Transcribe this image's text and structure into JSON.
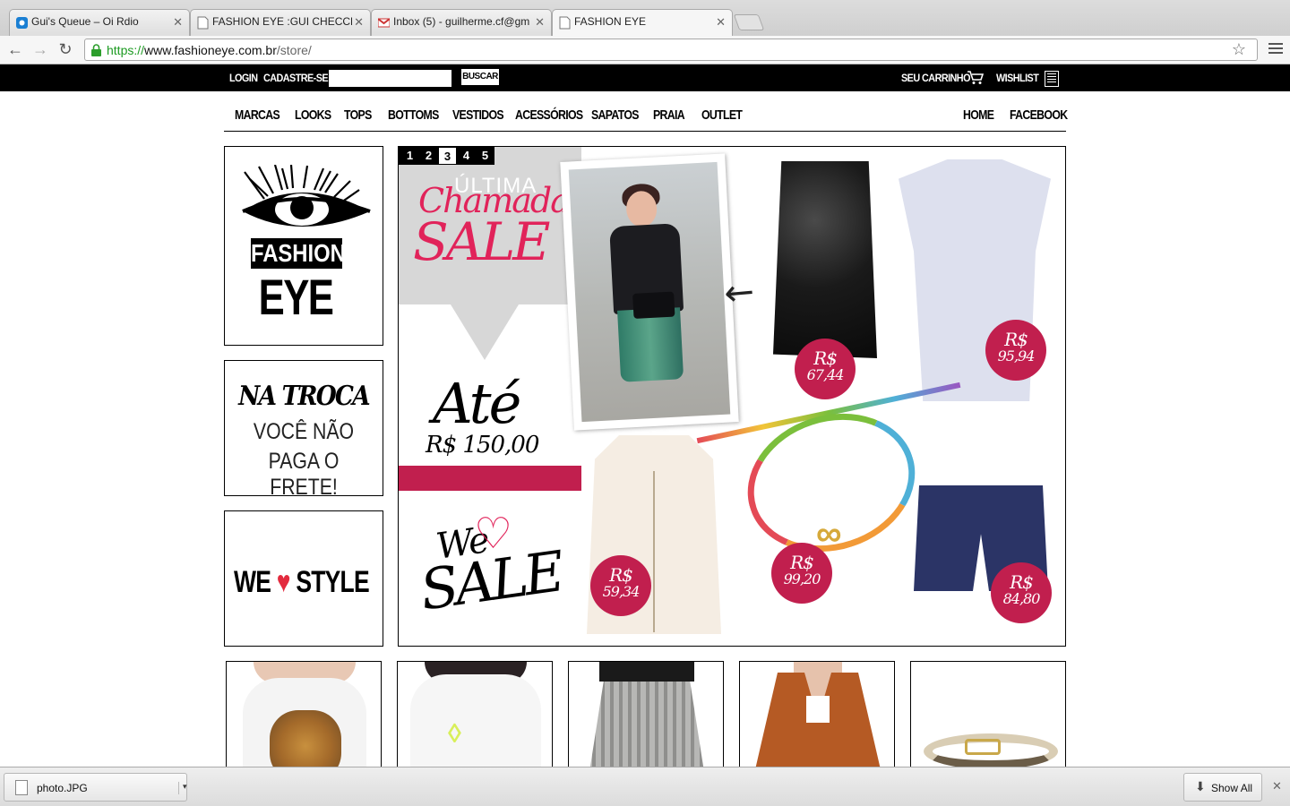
{
  "browser": {
    "tabs": [
      {
        "label": "Gui's Queue – Oi Rdio",
        "icon": "rdio-icon"
      },
      {
        "label": "FASHION EYE :GUI CHECCHIA",
        "icon": "page-icon"
      },
      {
        "label": "Inbox (5) - guilherme.cf@gm",
        "icon": "gmail-icon"
      },
      {
        "label": "FASHION EYE",
        "icon": "page-icon"
      }
    ],
    "url_scheme": "https://",
    "url_domain": "www.fashioneye.com.br",
    "url_path": "/store/"
  },
  "topbar": {
    "login": "LOGIN",
    "signup": "CADASTRE-SE",
    "search_value": "",
    "search_button": "BUSCAR",
    "cart": "SEU CARRINHO",
    "wishlist": "WISHLIST"
  },
  "nav": {
    "left": [
      "MARCAS",
      "LOOKS",
      "TOPS",
      "BOTTOMS",
      "VESTIDOS",
      "ACESSÓRIOS",
      "SAPATOS",
      "PRAIA",
      "OUTLET"
    ],
    "right": [
      "HOME",
      "FACEBOOK"
    ]
  },
  "logo": {
    "word1": "FASHION",
    "word2": "EYE"
  },
  "promo_troca": {
    "line1": "NA TROCA",
    "line2": "VOCÊ NÃO",
    "line3": "PAGA O FRETE!"
  },
  "promo_style": {
    "before": "WE",
    "heart": "♥",
    "after": "STYLE"
  },
  "banner": {
    "pages": [
      "1",
      "2",
      "3",
      "4",
      "5"
    ],
    "active_page": "3",
    "ultima": "ÚLTIMA",
    "chamada": "Chamada",
    "sale": "SALE",
    "ate": "Até",
    "ate_price": "R$ 150,00",
    "we": "We",
    "heart": "♡",
    "we_sale": "SALE",
    "prices": [
      {
        "currency": "R$",
        "value": "67,44"
      },
      {
        "currency": "R$",
        "value": "95,94"
      },
      {
        "currency": "R$",
        "value": "59,34"
      },
      {
        "currency": "R$",
        "value": "99,20"
      },
      {
        "currency": "R$",
        "value": "84,80"
      }
    ]
  },
  "products": [
    "leopard-tee",
    "gone-tee",
    "metallic-skirt",
    "orange-cardigan",
    "snake-belt"
  ],
  "downloads": {
    "file": "photo.JPG",
    "show_all": "Show All"
  }
}
